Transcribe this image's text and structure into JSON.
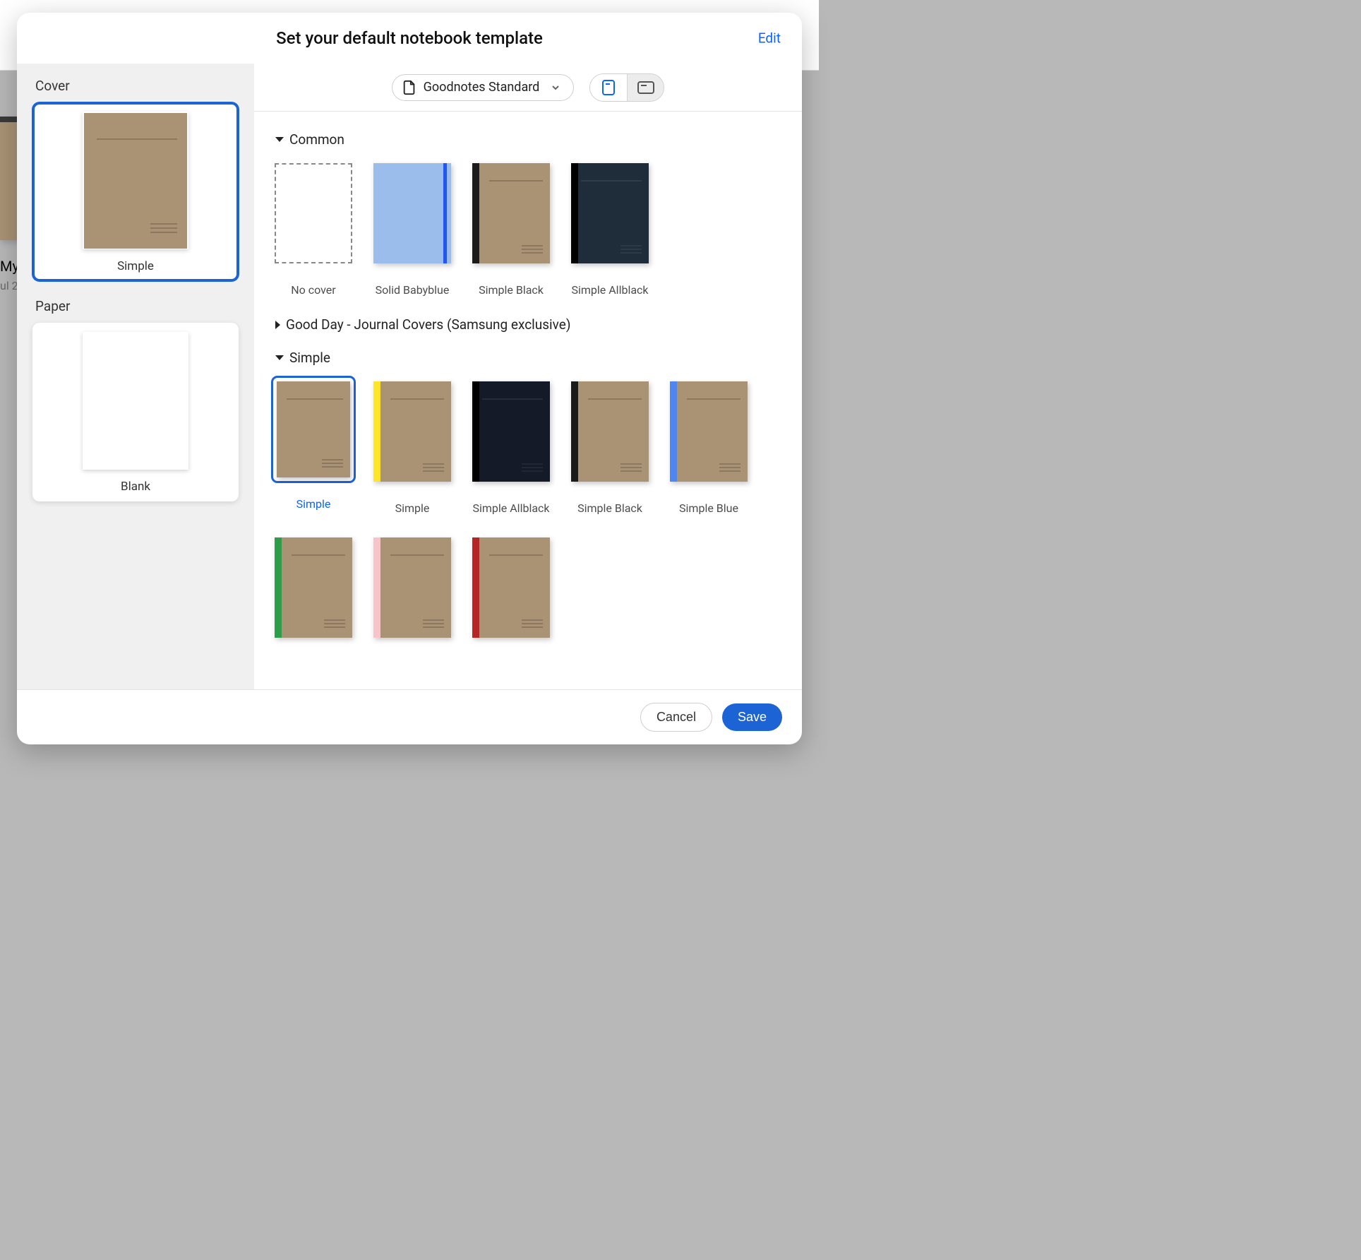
{
  "background": {
    "thumb_title": "My",
    "thumb_date": "ul 2"
  },
  "modal": {
    "title": "Set your default notebook template",
    "edit": "Edit"
  },
  "sidebar": {
    "cover_label": "Cover",
    "paper_label": "Paper",
    "cover_selected_name": "Simple",
    "paper_selected_name": "Blank"
  },
  "toolbar": {
    "dropdown_label": "Goodnotes Standard"
  },
  "sections": {
    "common": {
      "title": "Common",
      "items": [
        {
          "name": "No cover"
        },
        {
          "name": "Solid Babyblue"
        },
        {
          "name": "Simple Black"
        },
        {
          "name": "Simple Allblack"
        }
      ]
    },
    "goodday": {
      "title": "Good Day - Journal Covers (Samsung exclusive)"
    },
    "simple": {
      "title": "Simple",
      "items": [
        {
          "name": "Simple"
        },
        {
          "name": "Simple"
        },
        {
          "name": "Simple Allblack"
        },
        {
          "name": "Simple Black"
        },
        {
          "name": "Simple Blue"
        },
        {
          "name": ""
        },
        {
          "name": ""
        },
        {
          "name": ""
        }
      ],
      "spine_colors": {
        "yellow": "#ffe52a",
        "black": "#1b1b1b",
        "blue": "#4f86f0",
        "green": "#2e9d4a",
        "pink": "#f7c5c9",
        "red": "#b52427"
      }
    }
  },
  "footer": {
    "cancel": "Cancel",
    "save": "Save"
  }
}
